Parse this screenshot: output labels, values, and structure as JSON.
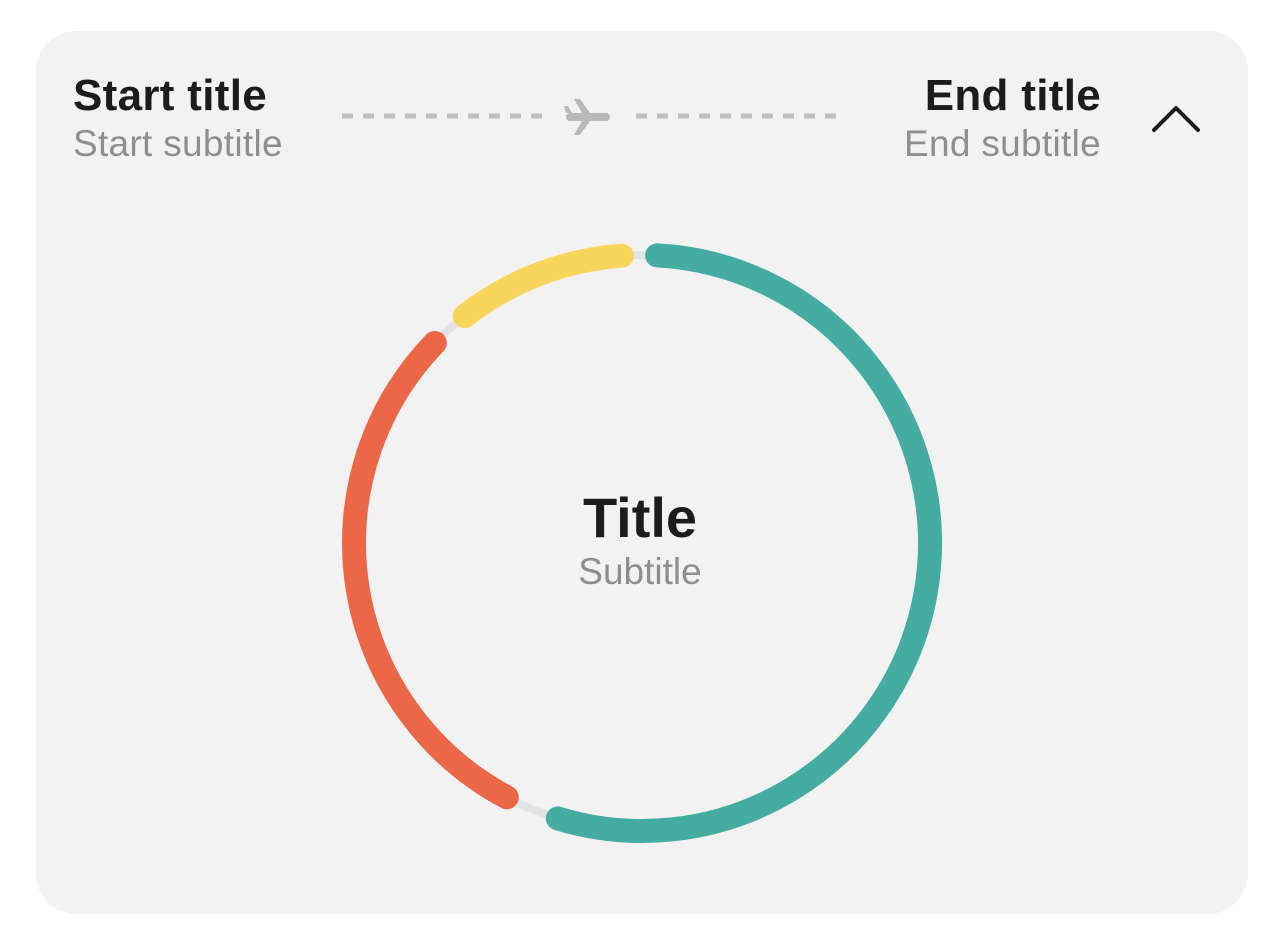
{
  "header": {
    "start_title": "Start title",
    "start_subtitle": "Start subtitle",
    "end_title": "End title",
    "end_subtitle": "End subtitle",
    "route_icon": "airplane-icon",
    "toggle_icon": "chevron-up-icon"
  },
  "center": {
    "title": "Title",
    "subtitle": "Subtitle"
  },
  "colors": {
    "card_background": "#f2f2f2",
    "track": "#e3e3e3",
    "teal": "#44aca1",
    "orange": "#ec6747",
    "yellow": "#f8d65c",
    "dash": "#c0c0c0",
    "title_text": "#1c1c1c",
    "subtitle_text": "#8e8e8e"
  },
  "chart_data": {
    "type": "donut",
    "unit": "degrees",
    "segments": [
      {
        "color": "#44aca1",
        "start": 3,
        "end": 197
      },
      {
        "color": "#ec6747",
        "start": 208,
        "end": 314
      },
      {
        "color": "#f8d65c",
        "start": 322,
        "end": 356
      }
    ]
  }
}
